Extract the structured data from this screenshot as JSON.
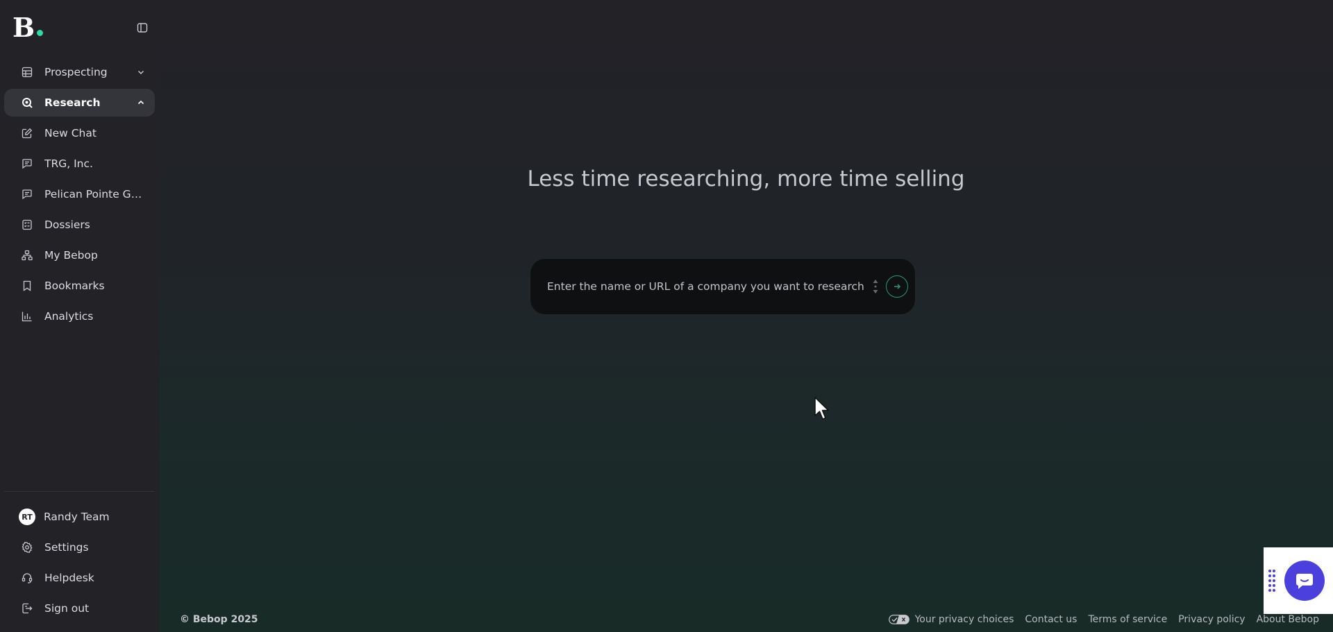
{
  "brand": {
    "logo_text": "B",
    "accent": "#2fd8a5"
  },
  "sidebar": {
    "items": [
      {
        "label": "Prospecting",
        "icon": "table-icon",
        "chevron": "down"
      },
      {
        "label": "Research",
        "icon": "search-icon",
        "chevron": "up",
        "active": true
      },
      {
        "label": "New Chat",
        "icon": "edit-icon"
      },
      {
        "label": "TRG, Inc.",
        "icon": "chat-icon"
      },
      {
        "label": "Pelican Pointe Golf ...",
        "icon": "chat-icon"
      },
      {
        "label": "Dossiers",
        "icon": "document-icon"
      },
      {
        "label": "My Bebop",
        "icon": "org-chart-icon"
      },
      {
        "label": "Bookmarks",
        "icon": "bookmark-icon"
      },
      {
        "label": "Analytics",
        "icon": "bar-chart-icon"
      }
    ],
    "bottom": {
      "user": {
        "initials": "RT",
        "name": "Randy Team"
      },
      "settings": "Settings",
      "helpdesk": "Helpdesk",
      "signout": "Sign out"
    }
  },
  "main": {
    "title": "Less time researching, more time selling",
    "search": {
      "placeholder": "Enter the name or URL of a company you want to research...",
      "value": ""
    }
  },
  "footer": {
    "copyright": "© Bebop 2025",
    "links": {
      "privacy_choices": "Your privacy choices",
      "contact": "Contact us",
      "terms": "Terms of service",
      "privacy_policy": "Privacy policy",
      "about": "About Bebop"
    }
  },
  "colors": {
    "chat_button": "#4b3fdd",
    "submit_ring": "#2e9a72"
  }
}
